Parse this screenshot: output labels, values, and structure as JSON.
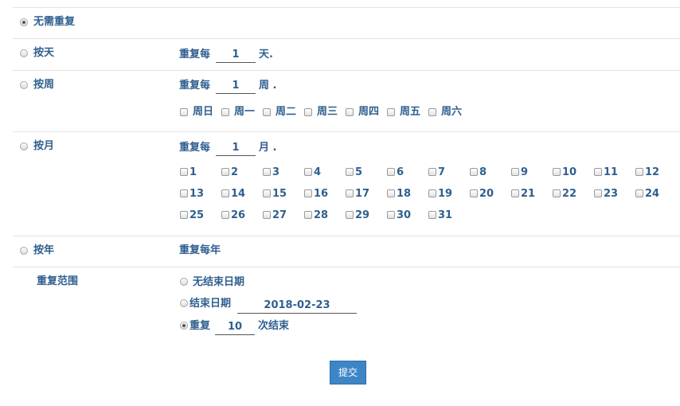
{
  "options": {
    "none": "无需重复",
    "daily": "按天",
    "weekly": "按周",
    "monthly": "按月",
    "yearly": "按年"
  },
  "daily": {
    "prefix": "重复每",
    "value": "1",
    "suffix": "天."
  },
  "weekly": {
    "prefix": "重复每",
    "value": "1",
    "suffix": "周 .",
    "days": [
      "周日",
      "周一",
      "周二",
      "周三",
      "周四",
      "周五",
      "周六"
    ]
  },
  "monthly": {
    "prefix": "重复每",
    "value": "1",
    "suffix": "月 .",
    "days": [
      "1",
      "2",
      "3",
      "4",
      "5",
      "6",
      "7",
      "8",
      "9",
      "10",
      "11",
      "12",
      "13",
      "14",
      "15",
      "16",
      "17",
      "18",
      "19",
      "20",
      "21",
      "22",
      "23",
      "24",
      "25",
      "26",
      "27",
      "28",
      "29",
      "30",
      "31"
    ]
  },
  "yearly": {
    "label": "重复每年"
  },
  "range": {
    "title": "重复范围",
    "no_end": "无结束日期",
    "end_date_label": "结束日期",
    "end_date_value": "2018-02-23",
    "repeat_prefix": "重复",
    "repeat_value": "10",
    "repeat_suffix": "次结束"
  },
  "submit_label": "提交"
}
